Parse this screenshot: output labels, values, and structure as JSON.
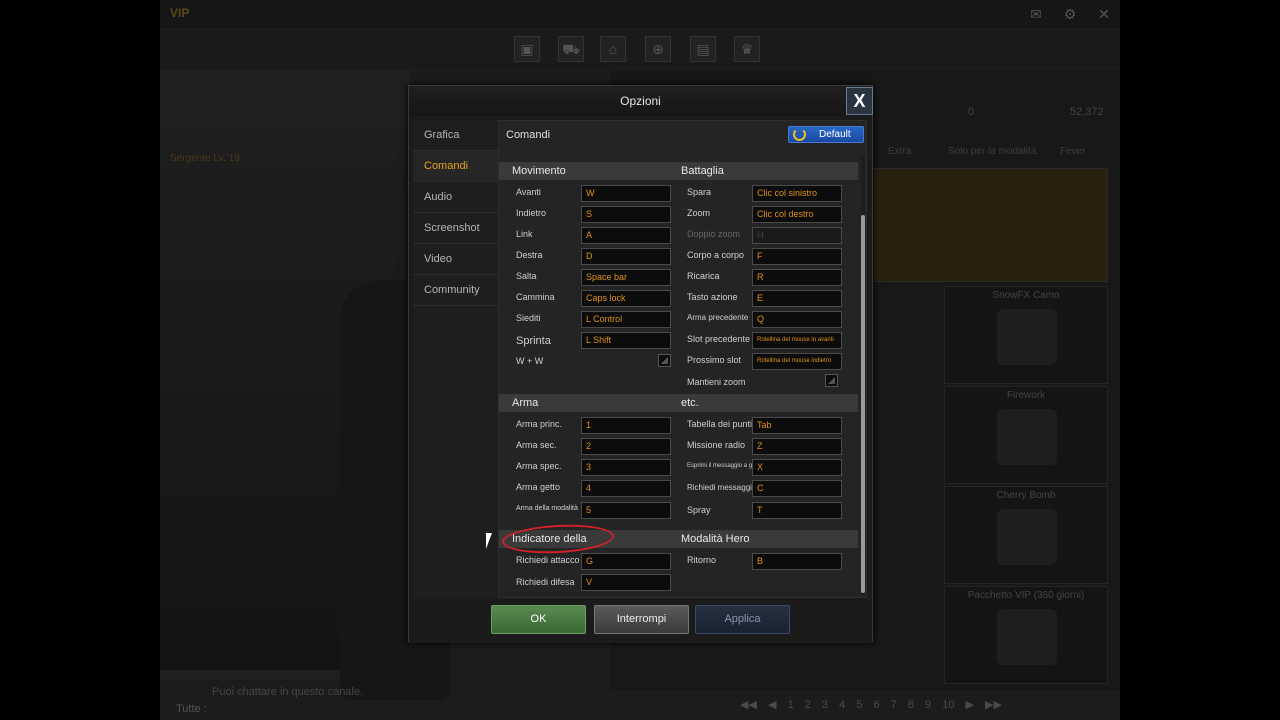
{
  "background": {
    "vip_label": "VIP",
    "rank_text": "Sergente Lv. 19",
    "chat_hint": "Puoi chattare in questo canale.",
    "chat_all": "Tutte :",
    "shop_tabs": [
      "Extra",
      "Solo per la modalità",
      "Fever"
    ],
    "currency": {
      "a": "0",
      "b": "52,372"
    },
    "cards": [
      {
        "title": "SnowFX Camo"
      },
      {
        "title": "Firework"
      },
      {
        "title": "Cherry Bomb"
      },
      {
        "title": "Pacchetto VIP (360 giorni)"
      }
    ],
    "pager": [
      "1",
      "2",
      "3",
      "4",
      "5",
      "6",
      "7",
      "8",
      "9",
      "10"
    ]
  },
  "dialog": {
    "title": "Opzioni",
    "close_label": "X",
    "nav": [
      "Grafica",
      "Comandi",
      "Audio",
      "Screenshot",
      "Video",
      "Community"
    ],
    "active_nav": "Comandi",
    "section_title": "Comandi",
    "default_label": "Default",
    "groups": {
      "movimento": {
        "title": "Movimento",
        "rows": [
          {
            "label": "Avanti",
            "key": "W"
          },
          {
            "label": "Indietro",
            "key": "S"
          },
          {
            "label": "Link",
            "key": "A"
          },
          {
            "label": "Destra",
            "key": "D"
          },
          {
            "label": "Salta",
            "key": "Space bar"
          },
          {
            "label": "Cammina",
            "key": "Caps lock"
          },
          {
            "label": "Siediti",
            "key": "L Control"
          },
          {
            "label": "Sprinta",
            "key": "L Shift"
          }
        ],
        "toggle_label": "W + W"
      },
      "battaglia": {
        "title": "Battaglia",
        "rows": [
          {
            "label": "Spara",
            "key": "Clic col sinistro"
          },
          {
            "label": "Zoom",
            "key": "Clic col destro"
          },
          {
            "label": "Doppio zoom",
            "key": "H"
          },
          {
            "label": "Corpo a corpo",
            "key": "F"
          },
          {
            "label": "Ricarica",
            "key": "R"
          },
          {
            "label": "Tasto azione",
            "key": "E"
          },
          {
            "label": "Arma precedente",
            "key": "Q"
          },
          {
            "label": "Slot precedente",
            "key": "Rotellina del mouse in avanti"
          },
          {
            "label": "Prossimo slot",
            "key": "Rotellina del mouse indietro"
          }
        ],
        "toggle_label": "Mantieni zoom"
      },
      "arma": {
        "title": "Arma",
        "rows": [
          {
            "label": "Arma princ.",
            "key": "1"
          },
          {
            "label": "Arma sec.",
            "key": "2"
          },
          {
            "label": "Arma spec.",
            "key": "3"
          },
          {
            "label": "Arma getto",
            "key": "4"
          },
          {
            "label": "Arma della modalità",
            "key": "5"
          }
        ]
      },
      "etc": {
        "title": "etc.",
        "rows": [
          {
            "label": "Tabella dei punti",
            "key": "Tab"
          },
          {
            "label": "Missione radio",
            "key": "Z"
          },
          {
            "label": "Esprimi il messaggio a gesti",
            "key": "X"
          },
          {
            "label": "Richiedi messaggio",
            "key": "C"
          },
          {
            "label": "Spray",
            "key": "T"
          }
        ]
      },
      "indicatore": {
        "title": "Indicatore della",
        "rows": [
          {
            "label": "Richiedi attacco",
            "key": "G"
          },
          {
            "label": "Richiedi difesa",
            "key": "V"
          }
        ]
      },
      "hero": {
        "title": "Modalità Hero",
        "rows": [
          {
            "label": "Ritorno",
            "key": "B"
          }
        ]
      }
    },
    "buttons": {
      "ok": "OK",
      "cancel": "Interrompi",
      "apply": "Applica"
    }
  },
  "colors": {
    "accent": "#e8a020",
    "key_text": "#e09018",
    "ok_green": "#4a7a40",
    "default_blue": "#2a66c8",
    "highlight_red": "#d0202a"
  }
}
